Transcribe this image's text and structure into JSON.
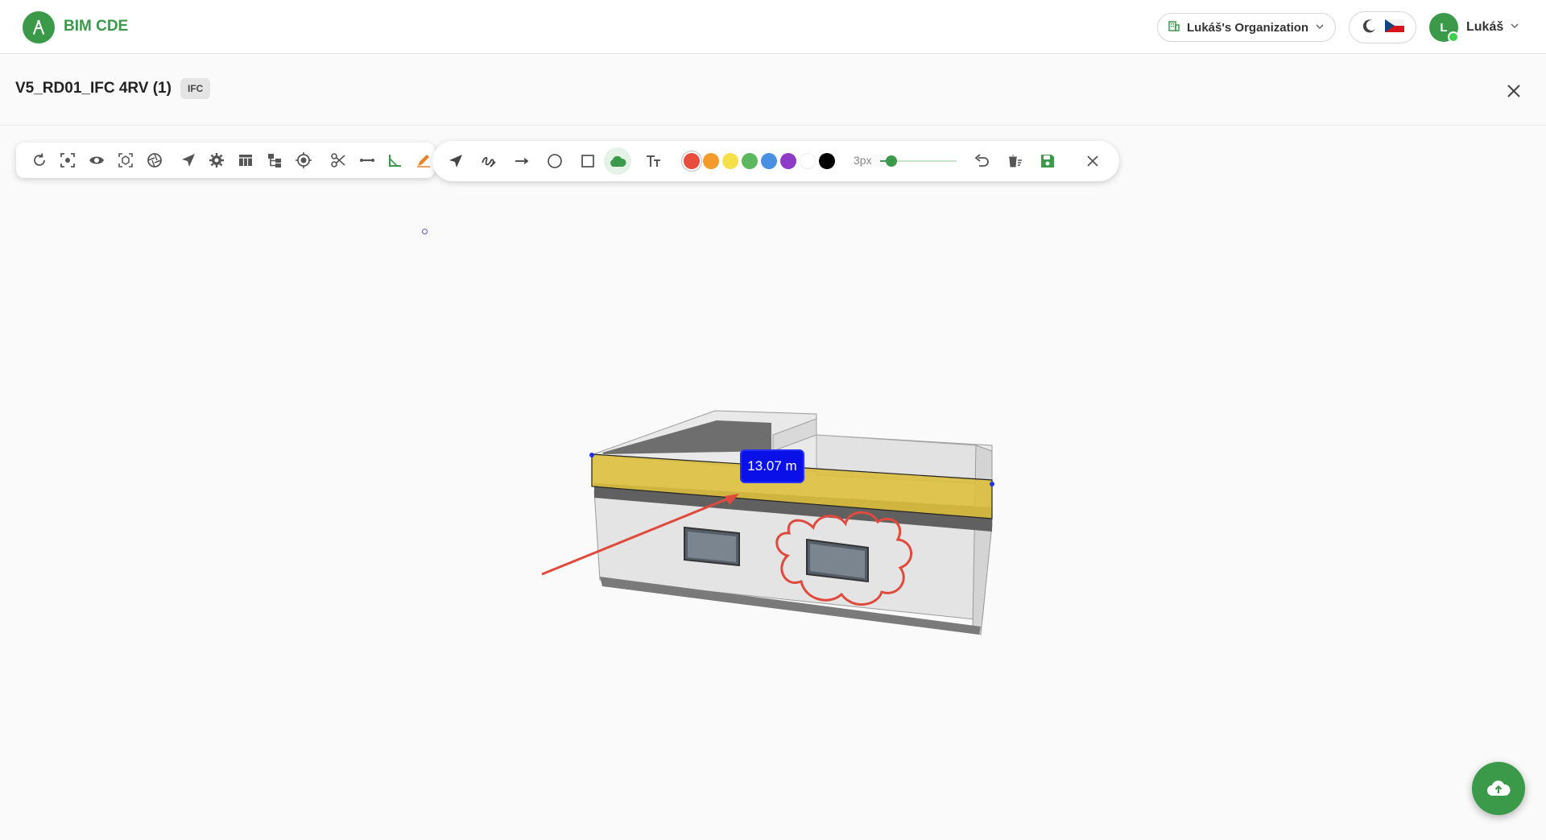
{
  "app": {
    "name": "BIM CDE",
    "brand_color": "#3a9a4a"
  },
  "header": {
    "organization_label": "Lukáš's Organization",
    "user_initial": "L",
    "user_name": "Lukáš",
    "language_flag": "cz-flag-icon",
    "theme_icon": "moon-icon"
  },
  "model": {
    "title": "V5_RD01_IFC 4RV (1)",
    "format_badge": "IFC"
  },
  "viewer_toolbar": {
    "tools": [
      "refresh-icon",
      "focus-icon",
      "visibility-icon",
      "isolate-icon",
      "aperture-icon",
      "navigate-icon",
      "settings-icon",
      "table-icon",
      "tree-icon",
      "target-icon",
      "section-cut-icon",
      "distance-icon",
      "angle-icon",
      "markup-icon"
    ]
  },
  "markup_toolbar": {
    "tools": [
      "pointer-icon",
      "freehand-icon",
      "arrow-line-icon",
      "circle-icon",
      "rectangle-icon",
      "cloud-icon",
      "text-icon"
    ],
    "active_tool": "cloud-icon",
    "colors": [
      "#e74c3c",
      "#f39c2b",
      "#f5e04a",
      "#5cb85c",
      "#4a90e2",
      "#8e3cc8",
      "#ffffff",
      "#000000"
    ],
    "selected_color": "#e74c3c",
    "stroke_label": "3px",
    "stroke_fraction": 0.15,
    "actions": [
      "undo-icon",
      "delete-icon",
      "save-icon",
      "close-icon"
    ]
  },
  "viewport": {
    "measurement_label": "13.07 m",
    "highlight_color": "#dcbf3c",
    "markup_color": "#e04a3c",
    "measurement_color": "#0a10e8"
  },
  "fab": {
    "icon": "cloud-upload-icon"
  }
}
